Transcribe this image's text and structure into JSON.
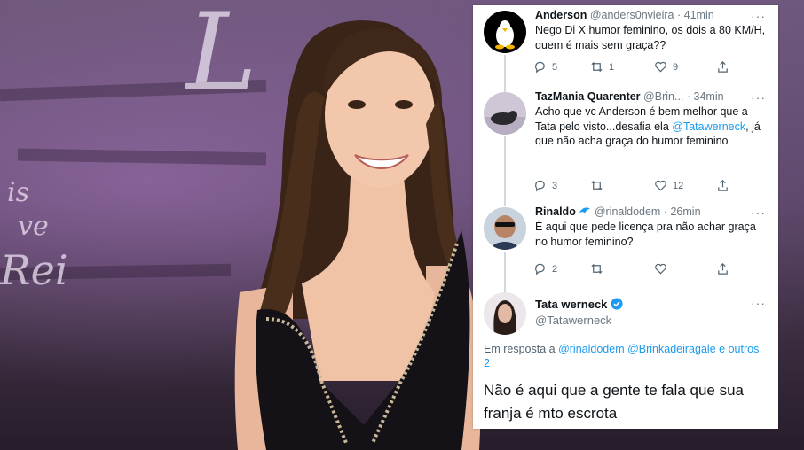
{
  "tweets": [
    {
      "name": "Anderson",
      "handle": "@anders0nvieira",
      "time": "41min",
      "text": "Nego Di  X humor feminino, os dois a 80 KM/H, quem é mais sem graça??",
      "replies": "5",
      "retweets": "1",
      "likes": "9"
    },
    {
      "name": "TazMania Quarenter",
      "handle": "@Brin...",
      "time": "34min",
      "text_before": "Acho que vc Anderson é bem melhor que a Tata pelo visto...desafia ela ",
      "mention": "@Tatawerneck",
      "text_after": ", já que não acha graça do humor feminino",
      "replies": "3",
      "retweets": "",
      "likes": "12"
    },
    {
      "name": "Rinaldo",
      "badge_icon": "dolphin-icon",
      "handle": "@rinaldodem",
      "time": "26min",
      "text": "É aqui que pede licença pra não achar graça no humor feminino?",
      "replies": "2",
      "retweets": "",
      "likes": ""
    }
  ],
  "main_tweet": {
    "name": "Tata werneck",
    "verified_icon": "verified-badge-icon",
    "handle": "@Tatawerneck",
    "reply_prefix": "Em resposta a",
    "reply_to_1": "@rinaldodem",
    "reply_to_2": "@Brinkadeiragale",
    "reply_conj": "e",
    "reply_others": "outros 2",
    "text": "Não é aqui que a gente te fala que sua franja é mto escrota"
  },
  "background": {
    "watermark_letters": "L",
    "watermark_lines": [
      "is",
      "ve",
      "Rei"
    ]
  },
  "colors": {
    "link": "#1d9bf0",
    "verified": "#1d9bf0",
    "text": "#0f1419",
    "muted": "#536471"
  }
}
